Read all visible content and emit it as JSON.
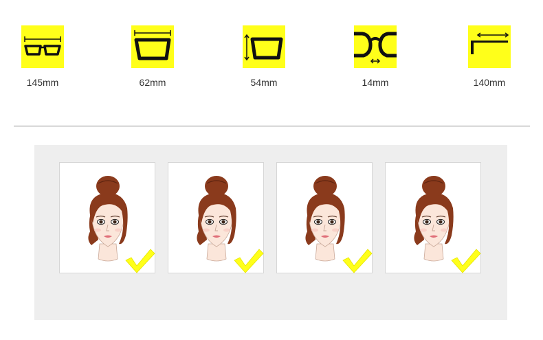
{
  "colors": {
    "accent_yellow": "#ffff1a",
    "frame_black": "#111111",
    "hair": "#8a3a1c",
    "skin": "#fbe6da",
    "panel_bg": "#eeeeee"
  },
  "measurements": [
    {
      "icon": "total-width-icon",
      "value": "145mm"
    },
    {
      "icon": "lens-width-icon",
      "value": "62mm"
    },
    {
      "icon": "lens-height-icon",
      "value": "54mm"
    },
    {
      "icon": "bridge-width-icon",
      "value": "14mm"
    },
    {
      "icon": "temple-length-icon",
      "value": "140mm"
    }
  ],
  "face_shapes": [
    {
      "icon": "face-illustration",
      "check": "checkmark-icon"
    },
    {
      "icon": "face-illustration",
      "check": "checkmark-icon"
    },
    {
      "icon": "face-illustration",
      "check": "checkmark-icon"
    },
    {
      "icon": "face-illustration",
      "check": "checkmark-icon"
    }
  ]
}
